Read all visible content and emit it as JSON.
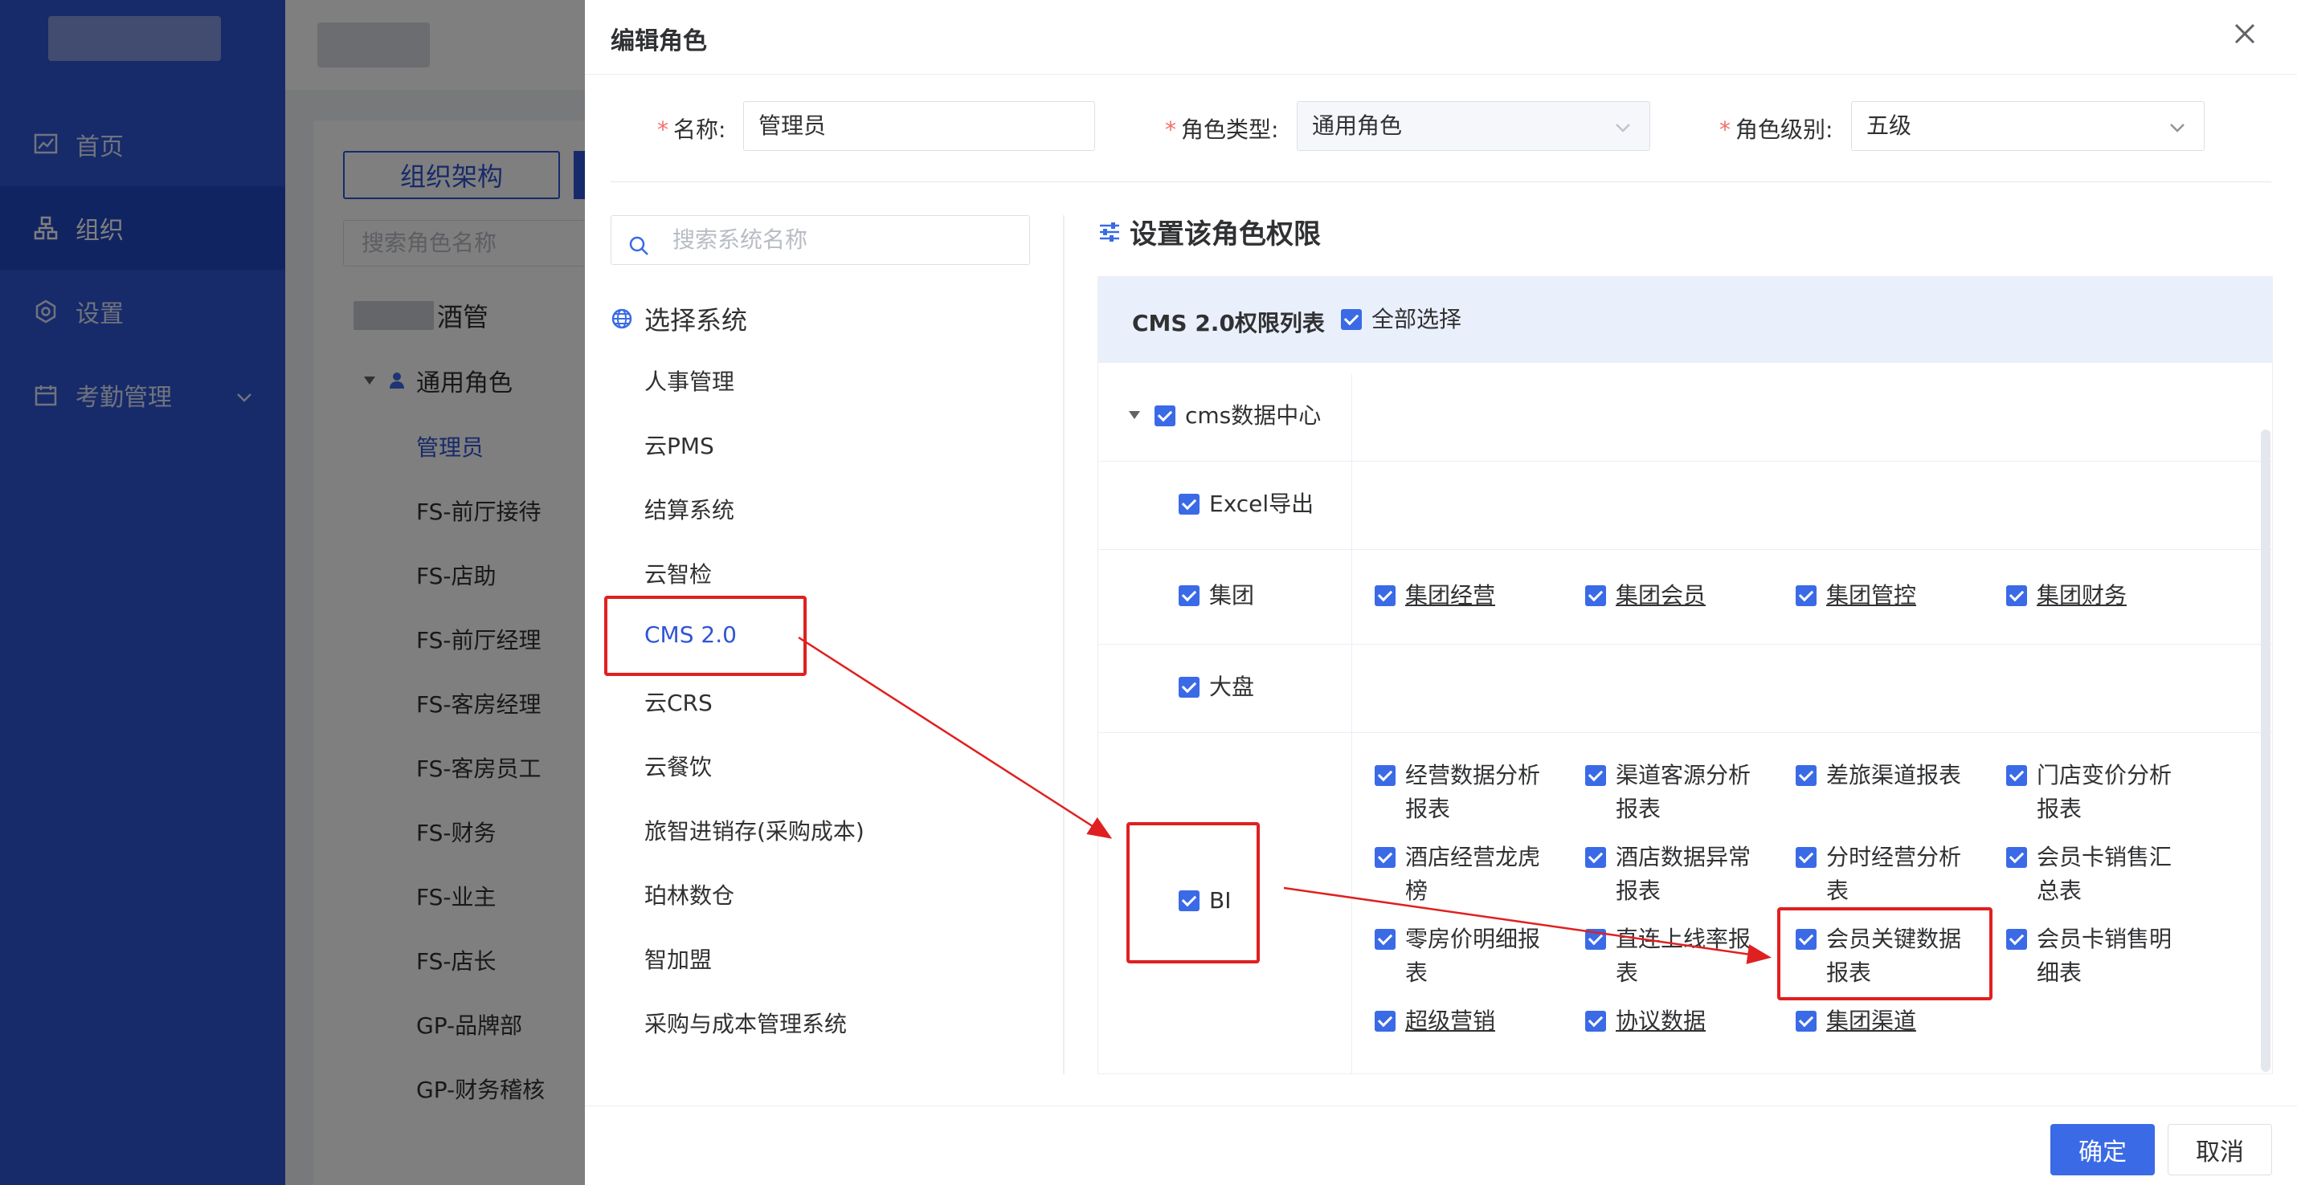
{
  "sidebar": {
    "items": [
      {
        "label": "首页",
        "icon": "chart-icon"
      },
      {
        "label": "组织",
        "icon": "org-icon"
      },
      {
        "label": "设置",
        "icon": "gear-icon"
      },
      {
        "label": "考勤管理",
        "icon": "attendance-icon"
      }
    ]
  },
  "background": {
    "org_button": "组织架构",
    "search_placeholder": "搜索角色名称",
    "org_name_suffix": "酒管",
    "group": "通用角色",
    "roles": [
      "管理员",
      "FS-前厅接待",
      "FS-店助",
      "FS-前厅经理",
      "FS-客房经理",
      "FS-客房员工",
      "FS-财务",
      "FS-业主",
      "FS-店长",
      "GP-品牌部",
      "GP-财务稽核"
    ]
  },
  "drawer": {
    "title": "编辑角色",
    "form": {
      "name_label": "名称:",
      "name_value": "管理员",
      "type_label": "角色类型:",
      "type_value": "通用角色",
      "level_label": "角色级别:",
      "level_value": "五级"
    },
    "system_search_placeholder": "搜索系统名称",
    "system_head": "选择系统",
    "systems": [
      "人事管理",
      "云PMS",
      "结算系统",
      "云智检",
      "CMS 2.0",
      "云CRS",
      "云餐饮",
      "旅智进销存(采购成本)",
      "珀林数仓",
      "智加盟",
      "采购与成本管理系统"
    ],
    "perm_title": "设置该角色权限",
    "table_name": "CMS 2.0权限列表",
    "select_all": "全部选择",
    "tree_root": "cms数据中心",
    "rows": {
      "excel": "Excel导出",
      "group": "集团",
      "group_items": [
        "集团经营",
        "集团会员",
        "集团管控",
        "集团财务"
      ],
      "dapan": "大盘",
      "bi": "BI",
      "bi_items": [
        [
          "经营数据分析",
          "报表"
        ],
        [
          "渠道客源分析",
          "报表"
        ],
        [
          "差旅渠道报表",
          ""
        ],
        [
          "门店变价分析",
          "报表"
        ],
        [
          "酒店经营龙虎",
          "榜"
        ],
        [
          "酒店数据异常",
          "报表"
        ],
        [
          "分时经营分析",
          "表"
        ],
        [
          "会员卡销售汇",
          "总表"
        ],
        [
          "零房价明细报",
          "表"
        ],
        [
          "直连上线率报",
          "表"
        ],
        [
          "会员关键数据",
          "报表"
        ],
        [
          "会员卡销售明",
          "细表"
        ],
        [
          "超级营销",
          ""
        ],
        [
          "协议数据",
          ""
        ],
        [
          "集团渠道",
          ""
        ]
      ]
    },
    "ok": "确定",
    "cancel": "取消"
  },
  "colors": {
    "primary": "#3a6ae6",
    "sidebar": "#2f55d4",
    "annotation": "#e02020"
  }
}
